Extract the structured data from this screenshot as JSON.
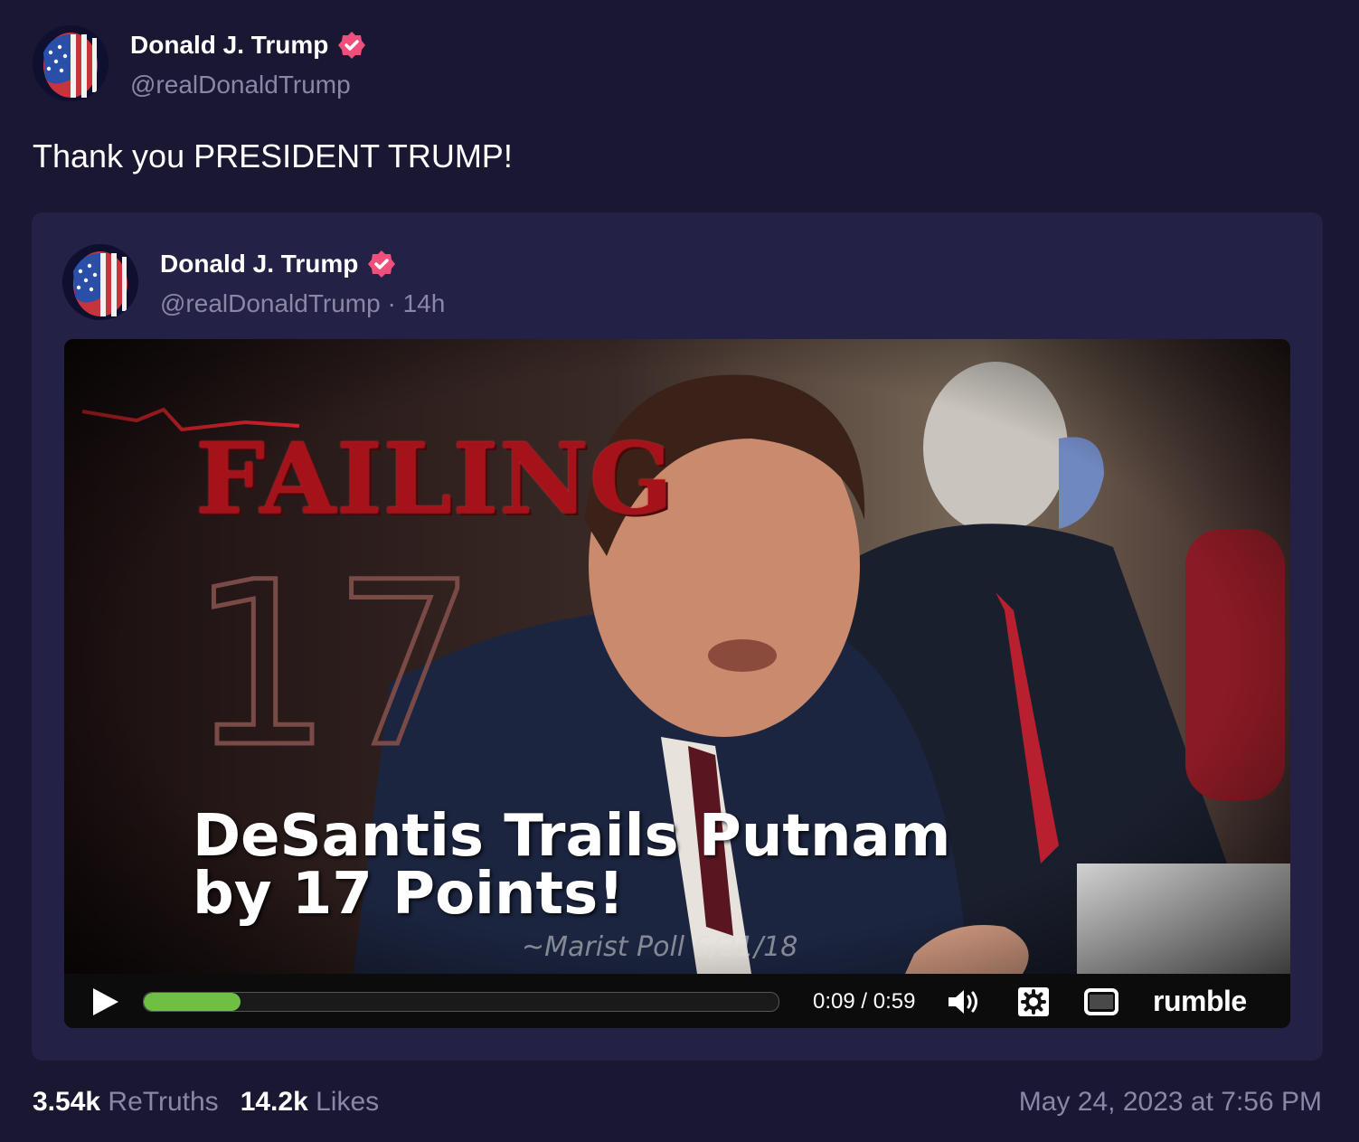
{
  "post": {
    "author": {
      "name": "Donald J. Trump",
      "handle": "@realDonaldTrump",
      "avatar_icon": "flag-face-avatar",
      "verified_icon": "verified-badge-icon"
    },
    "text": "Thank you PRESIDENT TRUMP!",
    "stats": {
      "retruths_count": "3.54k",
      "retruths_label": "ReTruths",
      "likes_count": "14.2k",
      "likes_label": "Likes"
    },
    "timestamp": "May 24, 2023 at 7:56 PM"
  },
  "quoted_post": {
    "author": {
      "name": "Donald J. Trump",
      "handle": "@realDonaldTrump",
      "age": "14h",
      "separator": "·"
    },
    "video": {
      "overlay_heading": "FAILING",
      "overlay_number": "17",
      "caption_line1": "DeSantis Trails Putnam",
      "caption_line2": "by 17 Points!",
      "source_note": "~Marist Poll 6/21/18",
      "player": {
        "time": "0:09 / 0:59",
        "progress_fraction": 0.152,
        "brand": "rumble",
        "icons": [
          "play-icon",
          "volume-icon",
          "settings-icon",
          "fullscreen-icon"
        ]
      }
    }
  },
  "colors": {
    "background": "#1a1733",
    "card": "#242146",
    "muted_text": "#8a86a6",
    "verified": "#ef4f7a",
    "progress": "#6fbf45",
    "failing_red": "#a5121a"
  }
}
